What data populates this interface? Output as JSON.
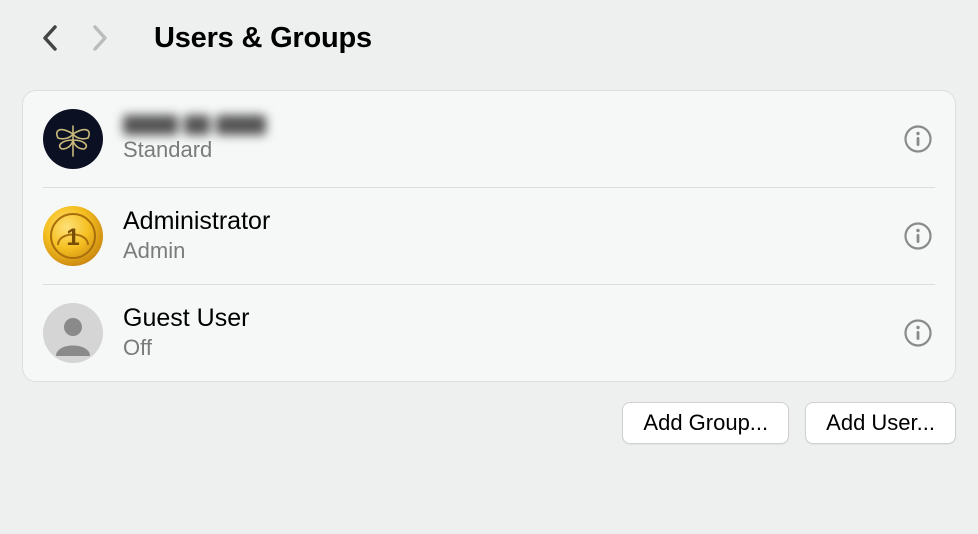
{
  "header": {
    "title": "Users & Groups"
  },
  "users": [
    {
      "name": "",
      "name_redacted": true,
      "role": "Standard",
      "avatar": "dragonfly"
    },
    {
      "name": "Administrator",
      "name_redacted": false,
      "role": "Admin",
      "avatar": "medal"
    },
    {
      "name": "Guest User",
      "name_redacted": false,
      "role": "Off",
      "avatar": "guest"
    }
  ],
  "buttons": {
    "add_group": "Add Group...",
    "add_user": "Add User..."
  }
}
